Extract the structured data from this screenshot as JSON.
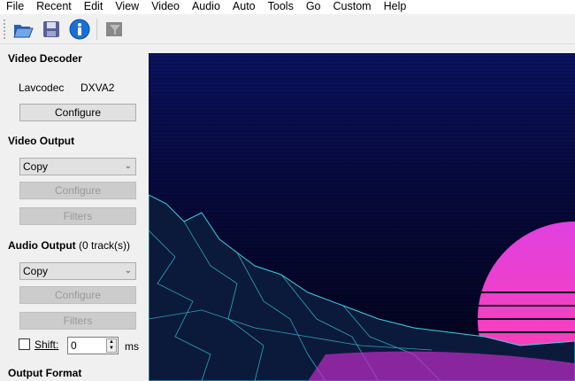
{
  "menu": [
    "File",
    "Recent",
    "Edit",
    "View",
    "Video",
    "Audio",
    "Auto",
    "Tools",
    "Go",
    "Custom",
    "Help"
  ],
  "toolbar": {
    "icons": [
      "open-folder-icon",
      "save-floppy-icon",
      "info-icon",
      "filter-film-icon"
    ]
  },
  "video_decoder": {
    "title": "Video Decoder",
    "decoder": "Lavcodec",
    "hw": "DXVA2",
    "configure": "Configure"
  },
  "video_output": {
    "title": "Video Output",
    "codec": "Copy",
    "configure": "Configure",
    "filters": "Filters"
  },
  "audio_output": {
    "title": "Audio Output",
    "tracks": "(0 track(s))",
    "codec": "Copy",
    "configure": "Configure",
    "filters": "Filters",
    "shift_label": "Shift:",
    "shift_value": "0",
    "shift_unit": "ms",
    "shift_checked": false
  },
  "output_format": {
    "title": "Output Format"
  }
}
